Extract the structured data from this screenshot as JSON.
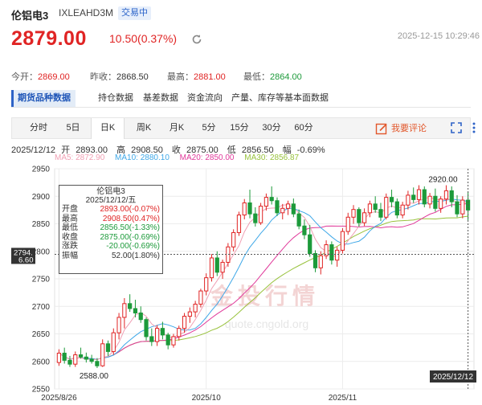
{
  "header": {
    "name": "伦铝电3",
    "code": "IXLEAHD3M",
    "status": "交易中",
    "price": "2879.00",
    "change": "10.50(0.37%)",
    "timestamp": "2025-12-15 10:29:46"
  },
  "stats": [
    {
      "label": "今开：",
      "value": "2869.00",
      "color": "red"
    },
    {
      "label": "昨收：",
      "value": "2868.50",
      "color": "dark"
    },
    {
      "label": "最高：",
      "value": "2881.00",
      "color": "red"
    },
    {
      "label": "最低：",
      "value": "2864.00",
      "color": "green"
    }
  ],
  "main_tabs": [
    "期货品种数据",
    "持仓数据",
    "基差数据",
    "资金流向",
    "产量、库存等基本面数据"
  ],
  "period_tabs": [
    "分时",
    "5日",
    "日K",
    "周K",
    "月K",
    "5分",
    "15分",
    "30分",
    "60分"
  ],
  "comment_label": "我要评论",
  "ohlc_line": {
    "date": "2025/12/12",
    "open_label": "开",
    "open": "2893.00",
    "high_label": "高",
    "high": "2908.50",
    "close_label": "收",
    "close": "2875.00",
    "low_label": "低",
    "low": "2856.50",
    "amp_label": "幅",
    "amp": "-0.69%"
  },
  "ma_legend": [
    {
      "label": "MA5: 2872.90",
      "color": "#f0a0b4"
    },
    {
      "label": "MA10: 2880.10",
      "color": "#3fa8e8"
    },
    {
      "label": "MA20: 2850.00",
      "color": "#e0399a"
    },
    {
      "label": "MA30: 2856.87",
      "color": "#98c23c"
    }
  ],
  "tooltip": {
    "title": "伦铝电3",
    "date": "2025/12/12/五",
    "rows": [
      {
        "k": "开盘",
        "v": "2893.00(-0.07%)",
        "color": "red"
      },
      {
        "k": "最高",
        "v": "2908.50(0.47%)",
        "color": "red"
      },
      {
        "k": "最低",
        "v": "2856.50(-1.33%)",
        "color": "green"
      },
      {
        "k": "收盘",
        "v": "2875.00(-0.69%)",
        "color": "green"
      },
      {
        "k": "涨跌",
        "v": "-20.00(-0.69%)",
        "color": "green"
      },
      {
        "k": "振幅",
        "v": "52.00(1.80%)",
        "color": "dark"
      }
    ]
  },
  "chart_data": {
    "type": "candlestick",
    "y_ticks": [
      "2950",
      "2900",
      "2850",
      "2800",
      "2750",
      "2700",
      "2650",
      "2600",
      "2550"
    ],
    "ylim": [
      2550,
      2950
    ],
    "x_ticks": [
      "2025/8/26",
      "2025/10",
      "2025/11"
    ],
    "x_tick_positions": [
      0,
      27,
      52
    ],
    "crosshair_date": "2025/12/12",
    "crosshair_value": "2794.",
    "crosshair_subvalue": "6.60",
    "annotations": [
      {
        "text": "2920.00",
        "index": 71,
        "value": 2920
      },
      {
        "text": "2588.00",
        "index": 7,
        "value": 2588
      }
    ],
    "watermark": "金投行情",
    "watermark_url": "quote.cngold.org",
    "ohlc": [
      [
        2598,
        2622,
        2592,
        2615
      ],
      [
        2615,
        2625,
        2596,
        2602
      ],
      [
        2602,
        2610,
        2590,
        2595
      ],
      [
        2595,
        2618,
        2590,
        2612
      ],
      [
        2612,
        2625,
        2605,
        2608
      ],
      [
        2608,
        2616,
        2598,
        2604
      ],
      [
        2604,
        2612,
        2596,
        2600
      ],
      [
        2600,
        2606,
        2588,
        2592
      ],
      [
        2592,
        2640,
        2590,
        2632
      ],
      [
        2632,
        2638,
        2610,
        2618
      ],
      [
        2618,
        2660,
        2612,
        2652
      ],
      [
        2652,
        2688,
        2640,
        2680
      ],
      [
        2680,
        2715,
        2660,
        2705
      ],
      [
        2705,
        2722,
        2690,
        2696
      ],
      [
        2696,
        2712,
        2680,
        2688
      ],
      [
        2688,
        2700,
        2670,
        2676
      ],
      [
        2676,
        2680,
        2638,
        2645
      ],
      [
        2645,
        2660,
        2628,
        2636
      ],
      [
        2636,
        2666,
        2628,
        2660
      ],
      [
        2660,
        2672,
        2640,
        2648
      ],
      [
        2648,
        2652,
        2622,
        2630
      ],
      [
        2630,
        2650,
        2625,
        2645
      ],
      [
        2645,
        2665,
        2638,
        2660
      ],
      [
        2660,
        2688,
        2652,
        2682
      ],
      [
        2682,
        2698,
        2670,
        2690
      ],
      [
        2690,
        2710,
        2680,
        2704
      ],
      [
        2704,
        2732,
        2698,
        2728
      ],
      [
        2728,
        2760,
        2720,
        2752
      ],
      [
        2752,
        2795,
        2745,
        2788
      ],
      [
        2788,
        2800,
        2755,
        2762
      ],
      [
        2762,
        2785,
        2750,
        2780
      ],
      [
        2780,
        2815,
        2772,
        2808
      ],
      [
        2808,
        2840,
        2800,
        2834
      ],
      [
        2834,
        2872,
        2828,
        2866
      ],
      [
        2866,
        2895,
        2858,
        2888
      ],
      [
        2888,
        2912,
        2860,
        2868
      ],
      [
        2868,
        2880,
        2845,
        2852
      ],
      [
        2852,
        2888,
        2848,
        2882
      ],
      [
        2882,
        2905,
        2874,
        2898
      ],
      [
        2898,
        2918,
        2885,
        2892
      ],
      [
        2892,
        2898,
        2864,
        2870
      ],
      [
        2870,
        2886,
        2858,
        2878
      ],
      [
        2878,
        2892,
        2866,
        2886
      ],
      [
        2886,
        2896,
        2862,
        2868
      ],
      [
        2868,
        2876,
        2840,
        2846
      ],
      [
        2846,
        2858,
        2822,
        2830
      ],
      [
        2830,
        2848,
        2790,
        2796
      ],
      [
        2796,
        2802,
        2762,
        2770
      ],
      [
        2770,
        2800,
        2758,
        2792
      ],
      [
        2792,
        2820,
        2786,
        2812
      ],
      [
        2812,
        2818,
        2776,
        2784
      ],
      [
        2784,
        2808,
        2772,
        2802
      ],
      [
        2802,
        2842,
        2796,
        2836
      ],
      [
        2836,
        2870,
        2830,
        2862
      ],
      [
        2862,
        2884,
        2850,
        2876
      ],
      [
        2876,
        2880,
        2845,
        2852
      ],
      [
        2852,
        2878,
        2846,
        2870
      ],
      [
        2870,
        2892,
        2862,
        2886
      ],
      [
        2886,
        2900,
        2870,
        2876
      ],
      [
        2876,
        2888,
        2855,
        2862
      ],
      [
        2862,
        2905,
        2858,
        2898
      ],
      [
        2898,
        2912,
        2880,
        2890
      ],
      [
        2890,
        2896,
        2860,
        2866
      ],
      [
        2866,
        2890,
        2860,
        2884
      ],
      [
        2884,
        2910,
        2876,
        2902
      ],
      [
        2902,
        2916,
        2888,
        2894
      ],
      [
        2894,
        2920,
        2885,
        2912
      ],
      [
        2912,
        2918,
        2880,
        2886
      ],
      [
        2886,
        2906,
        2878,
        2900
      ],
      [
        2900,
        2914,
        2872,
        2878
      ],
      [
        2878,
        2900,
        2870,
        2895
      ],
      [
        2895,
        2920,
        2885,
        2910
      ],
      [
        2910,
        2918,
        2880,
        2890
      ],
      [
        2890,
        2902,
        2862,
        2868
      ],
      [
        2868,
        2900,
        2860,
        2893
      ],
      [
        2893,
        2908.5,
        2856.5,
        2875
      ]
    ]
  }
}
